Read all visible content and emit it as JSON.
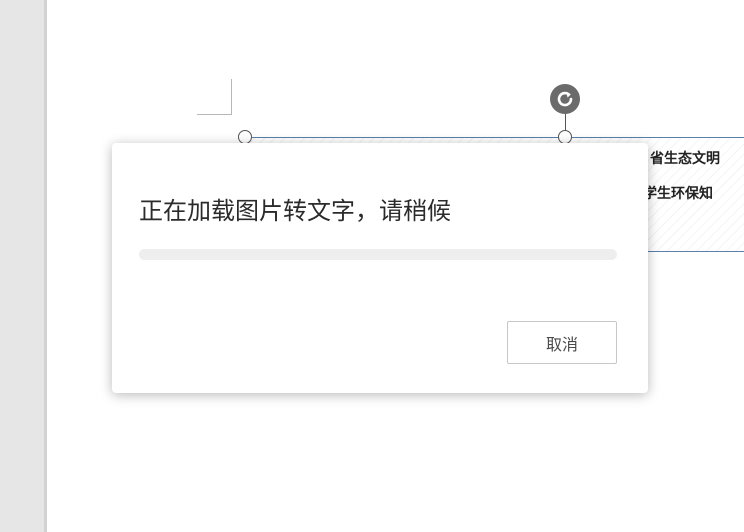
{
  "document": {
    "image_text_lines": [
      "省生态文明",
      "学生环保知"
    ]
  },
  "dialog": {
    "title": "正在加载图片转文字，请稍候",
    "progress": 0,
    "cancel_label": "取消"
  },
  "icons": {
    "rotate_handle": "rotate-icon"
  },
  "colors": {
    "progress_fill": "#4a90e2",
    "progress_track": "#eeeeee",
    "selection_border": "#5a7fa8"
  }
}
